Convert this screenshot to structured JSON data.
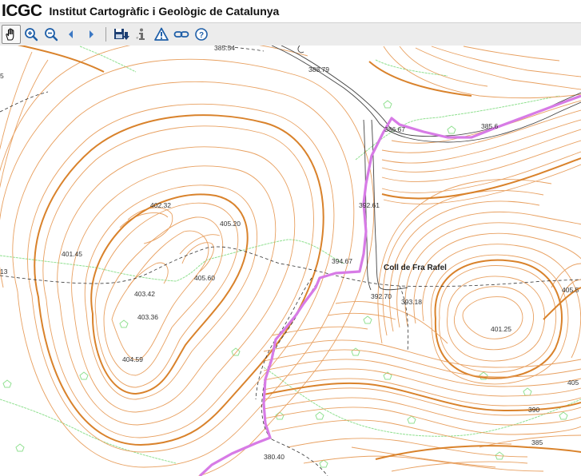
{
  "header": {
    "logo": "ICGC",
    "title": "Institut Cartogràfic i Geològic de Catalunya"
  },
  "toolbar": {
    "tools": [
      {
        "icon": "pan-hand-icon",
        "active": true
      },
      {
        "icon": "zoom-in-icon"
      },
      {
        "icon": "zoom-out-icon"
      },
      {
        "icon": "back-arrow-icon"
      },
      {
        "icon": "forward-arrow-icon"
      },
      {
        "icon": "save-download-icon"
      },
      {
        "icon": "info-icon"
      },
      {
        "icon": "warning-icon"
      },
      {
        "icon": "link-icon"
      },
      {
        "icon": "help-icon"
      }
    ]
  },
  "map": {
    "place_label": "Coll de Fra Rafel",
    "elevations": [
      "385.54",
      "388.79",
      "386.67",
      "385.6",
      "392.61",
      "402.32",
      "405.20",
      "401.45",
      "394.67",
      "405.60",
      "403.42",
      "392.70",
      "393.18",
      "403.36",
      "401.25",
      "404.59",
      "380.40",
      "390",
      "385",
      "405.5",
      "405",
      "13",
      "5"
    ],
    "colors": {
      "contour": "#e8a060",
      "contour_index": "#d9822b",
      "route": "#d77be6",
      "road": "#444444",
      "vegetation": "#90e090"
    }
  }
}
